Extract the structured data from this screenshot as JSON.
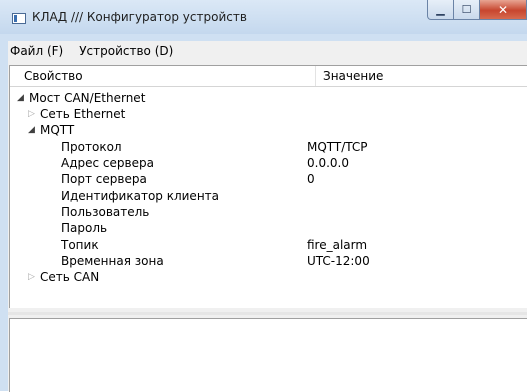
{
  "window": {
    "title": "КЛАД /// Конфигуратор устройств",
    "minimize_glyph": "▁",
    "maximize_glyph": "☐",
    "close_glyph": "✕"
  },
  "menu": [
    {
      "label": "Файл (F)"
    },
    {
      "label": "Устройство (D)"
    }
  ],
  "grid": {
    "columns": {
      "property": "Свойство",
      "value": "Значение"
    },
    "rows": {
      "root": {
        "arrow": "◢",
        "label": "Мост CAN/Ethernet"
      },
      "ethernet": {
        "arrow": "▷",
        "label": "Сеть Ethernet"
      },
      "mqtt": {
        "arrow": "◢",
        "label": "MQTT"
      },
      "protocol": {
        "label": "Протокол",
        "value": "MQTT/TCP"
      },
      "server_address": {
        "label": "Адрес сервера",
        "value": "0.0.0.0"
      },
      "server_port": {
        "label": "Порт сервера",
        "value": "0"
      },
      "client_id": {
        "label": "Идентификатор клиента",
        "value": ""
      },
      "user": {
        "label": "Пользователь",
        "value": ""
      },
      "password": {
        "label": "Пароль",
        "value": ""
      },
      "topic": {
        "label": "Топик",
        "value": "fire_alarm"
      },
      "timezone": {
        "label": "Временная зона",
        "value": "UTC-12:00"
      },
      "can": {
        "arrow": "▷",
        "label": "Сеть CAN"
      }
    }
  }
}
